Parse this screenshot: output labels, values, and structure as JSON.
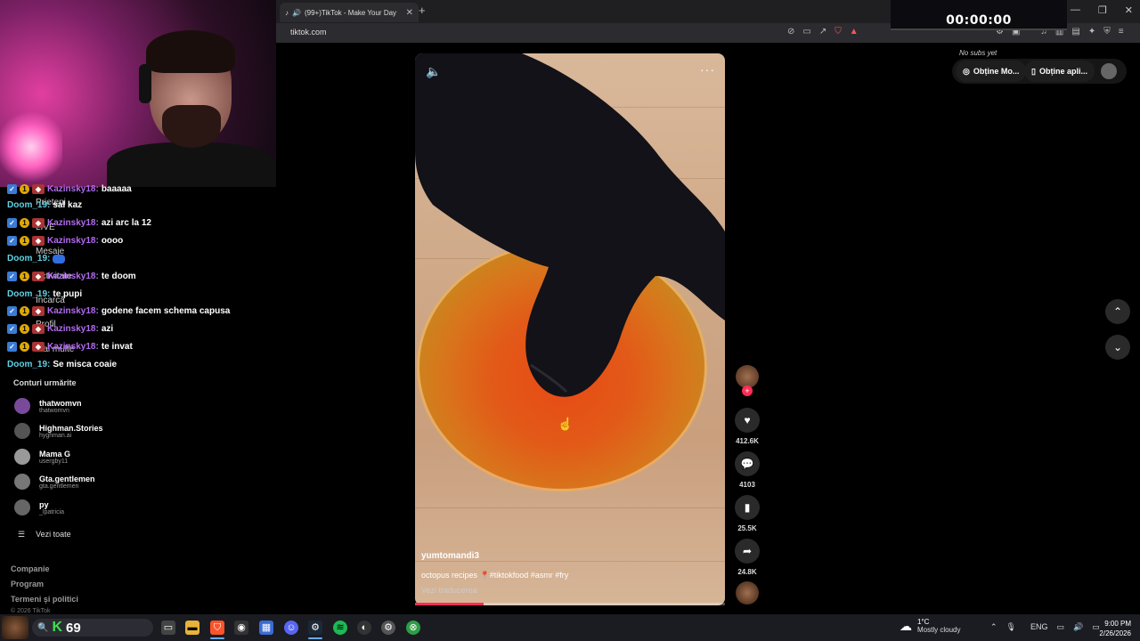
{
  "browser": {
    "tab_title": "(99+)TikTok - Make Your Day",
    "url": "tiktok.com"
  },
  "stream": {
    "timer": "00:00:00"
  },
  "chat": [
    {
      "nick": "Kazinsky18:",
      "msg": "baaaaa",
      "color": "purple"
    },
    {
      "nick": "Doom_19:",
      "msg": "sal kaz",
      "color": "cyan"
    },
    {
      "nick": "Kazinsky18:",
      "msg": "azi arc la 12",
      "color": "purple"
    },
    {
      "nick": "Kazinsky18:",
      "msg": "oooo",
      "color": "purple"
    },
    {
      "nick": "Doom_19:",
      "msg": "",
      "color": "cyan"
    },
    {
      "nick": "Kazinsky18:",
      "msg": "te       doom",
      "color": "purple"
    },
    {
      "nick": "Doom_19:",
      "msg": "te pupi",
      "color": "cyan"
    },
    {
      "nick": "Kazinsky18:",
      "msg": "godene facem schema capusa",
      "color": "purple"
    },
    {
      "nick": "Kazinsky18:",
      "msg": "azi",
      "color": "purple"
    },
    {
      "nick": "Kazinsky18:",
      "msg": "te invat",
      "color": "purple"
    },
    {
      "nick": "Doom_19:",
      "msg": "Se misca coaie",
      "color": "cyan"
    }
  ],
  "sidebar_ghost": {
    "friends": "Prieteni",
    "live": "LIVE",
    "messages": "Mesaje",
    "activity": "Activitate",
    "upload": "Încarcă",
    "profile": "Profil",
    "more": "Mai multe"
  },
  "following": {
    "title": "Conturi urmărite",
    "accounts": [
      {
        "name": "thatwomvn",
        "handle": "thatwomvn"
      },
      {
        "name": "Highman.Stories",
        "handle": "hyghman.ai"
      },
      {
        "name": "Mama G",
        "handle": "usergby11"
      },
      {
        "name": "Gta.gentlemen",
        "handle": "gta.gentlemen"
      },
      {
        "name": "py",
        "handle": "_lpatricia"
      }
    ],
    "see_all": "Vezi toate"
  },
  "footer": {
    "company": "Companie",
    "program": "Program",
    "terms": "Termeni și politici",
    "copyright": "© 2026 TikTok"
  },
  "video": {
    "username": "yumtomandi3",
    "description": "octopus recipes 📍#tiktokfood #asmr #fry",
    "translate": "Vezi traducerea",
    "progress": 0.22
  },
  "actions": {
    "likes": "412.6K",
    "comments": "4103",
    "saves": "25.5K",
    "shares": "24.8K"
  },
  "topright": {
    "no_subs": "No subs yet",
    "get_more": "Obține Mo...",
    "get_app": "Obține apli..."
  },
  "taskbar": {
    "kick_count": "69",
    "temp": "1°C",
    "condition": "Mostly cloudy",
    "lang": "ENG",
    "time": "9:00 PM",
    "date": "2/26/2026"
  },
  "colors": {
    "accent": "#fe2c55",
    "nick_purple": "#b16cf0",
    "nick_cyan": "#5fd3e6",
    "kick_green": "#3fe04f"
  }
}
